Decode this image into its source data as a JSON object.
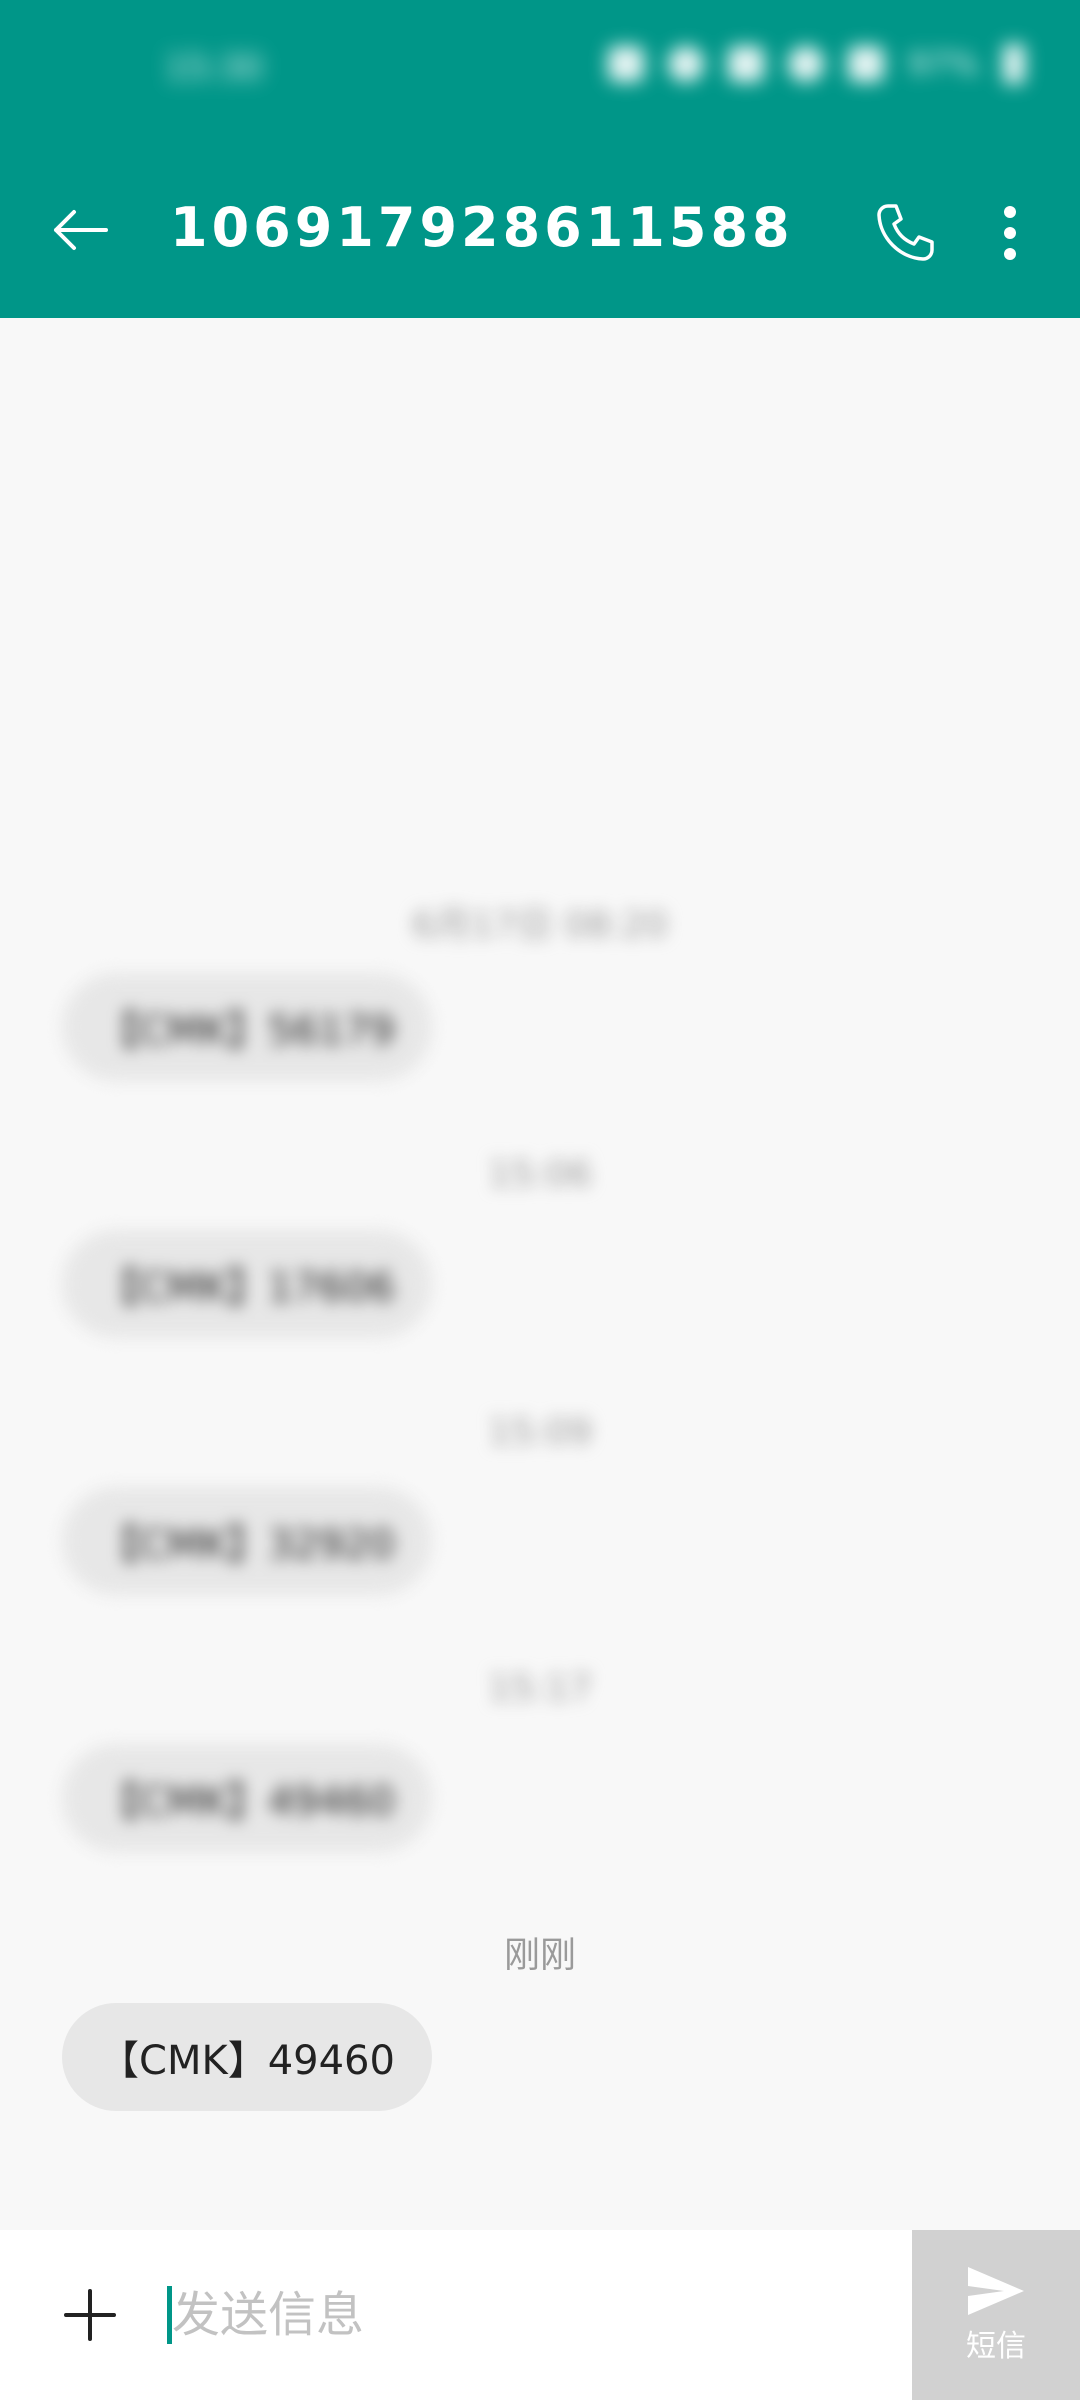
{
  "status_bar": {
    "time": "15:30",
    "battery_percent": "97%"
  },
  "app_bar": {
    "title": "106917928611588",
    "icons": {
      "back": "arrow-left-icon",
      "call": "phone-icon",
      "more": "more-vertical-icon"
    }
  },
  "conversation": {
    "items": [
      {
        "timestamp": "6月17日 08:20",
        "message": "【CMK】56179"
      },
      {
        "timestamp": "15:06",
        "message": "【CMK】17606"
      },
      {
        "timestamp": "15:09",
        "message": "【CMK】32920"
      },
      {
        "timestamp": "15:17",
        "message": "【CMK】49460"
      },
      {
        "timestamp": "刚刚",
        "message": "【CMK】49460"
      }
    ]
  },
  "composer": {
    "placeholder": "发送信息",
    "value": "",
    "send_label": "短信",
    "icons": {
      "add": "plus-icon",
      "send": "send-icon"
    }
  },
  "colors": {
    "primary": "#009688",
    "background": "#f8f8f8",
    "bubble": "#e7e7e7",
    "send_button": "#d1d1d1"
  }
}
